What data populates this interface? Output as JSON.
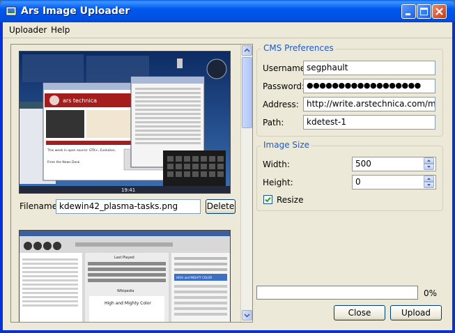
{
  "window": {
    "title": "Ars Image Uploader"
  },
  "menu": [
    "Uploader",
    "Help"
  ],
  "images": [
    {
      "filename_label": "Filename:",
      "filename": "kdewin42_plasma-tasks.png",
      "delete_label": "Delete",
      "shot_text": {
        "site": "ars technica",
        "tagline": "the art of technology",
        "clock": "19:41",
        "links": [
          "This week in open source: GTK+, Evolution,",
          "From the News Desk"
        ]
      }
    },
    {
      "shot_text": {
        "header": "Last Played",
        "song": "High and Mighty Color",
        "tab": "Wikipedia",
        "playlist_title": "HIGH and MIGHTY COLOR"
      }
    }
  ],
  "cms": {
    "group_title": "CMS Preferences",
    "username_label": "Username:",
    "username": "segphault",
    "password_label": "Password:",
    "password": "●●●●●●●●●●●●●●●●●●",
    "address_label": "Address:",
    "address": "http://write.arstechnica.com/mt-xmlrpc",
    "path_label": "Path:",
    "path": "kdetest-1"
  },
  "image_size": {
    "group_title": "Image Size",
    "width_label": "Width:",
    "width": "500",
    "height_label": "Height:",
    "height": "0",
    "resize_label": "Resize",
    "resize_checked": true
  },
  "progress": {
    "percent_text": "0%",
    "value": 0
  },
  "buttons": {
    "close": "Close",
    "upload": "Upload"
  },
  "colors": {
    "titlebar": "#0058ee",
    "accent": "#1c5ac8",
    "background": "#ece9d8",
    "close_button": "#c8381b"
  }
}
